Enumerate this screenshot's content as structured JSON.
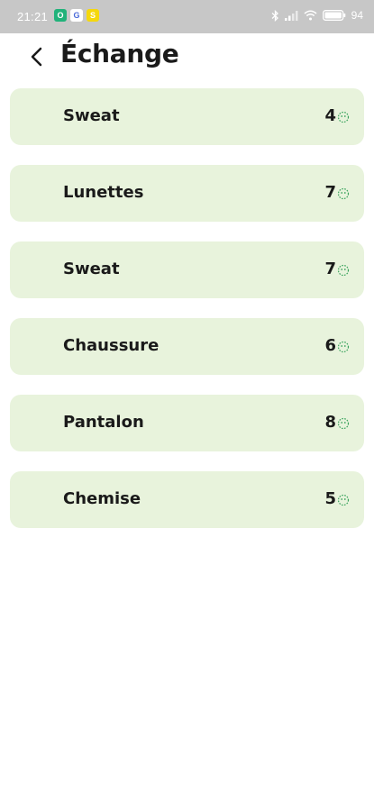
{
  "status_bar": {
    "time": "21:21",
    "app_icons": [
      "O",
      "G",
      "S"
    ],
    "battery": "94"
  },
  "header": {
    "title": "Échange",
    "back_icon": "chevron-left-icon"
  },
  "items": [
    {
      "name": "Sweat",
      "value": "4"
    },
    {
      "name": "Lunettes",
      "value": "7"
    },
    {
      "name": "Sweat",
      "value": "7"
    },
    {
      "name": "Chaussure",
      "value": "6"
    },
    {
      "name": "Pantalon",
      "value": "8"
    },
    {
      "name": "Chemise",
      "value": "5"
    }
  ],
  "colors": {
    "card_background": "#e8f3dc",
    "coin_green": "#3aa35c",
    "status_bar": "#c7c7c7"
  }
}
